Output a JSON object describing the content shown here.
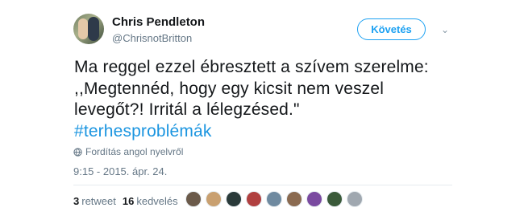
{
  "author": {
    "name": "Chris Pendleton",
    "handle": "@ChrisnotBritton"
  },
  "follow_button": {
    "label": "Követés"
  },
  "tweet": {
    "lines": [
      "Ma reggel ezzel ébresztett a szívem szerelme:",
      ",,Megtennéd, hogy egy kicsit nem veszel",
      "levegőt?! Irritál a lélegzésed.\""
    ],
    "hashtag": "#terhesproblémák"
  },
  "translate_link": "Fordítás angol nyelvről",
  "timestamp": "9:15 - 2015. ápr. 24.",
  "stats": {
    "retweets_count": "3",
    "retweets_label": "retweet",
    "likes_count": "16",
    "likes_label": "kedvelés"
  },
  "colors": {
    "accent": "#1da1f2",
    "hashtag": "#1b95e0",
    "muted": "#657786"
  },
  "likers": [
    {
      "color": "#6b5a4a"
    },
    {
      "color": "#c9a070"
    },
    {
      "color": "#2a3a3a"
    },
    {
      "color": "#b04040"
    },
    {
      "color": "#6f8aa0"
    },
    {
      "color": "#8a6a50"
    },
    {
      "color": "#7a4aa0"
    },
    {
      "color": "#3a5a3a"
    },
    {
      "color": "#a0a8b0"
    }
  ]
}
